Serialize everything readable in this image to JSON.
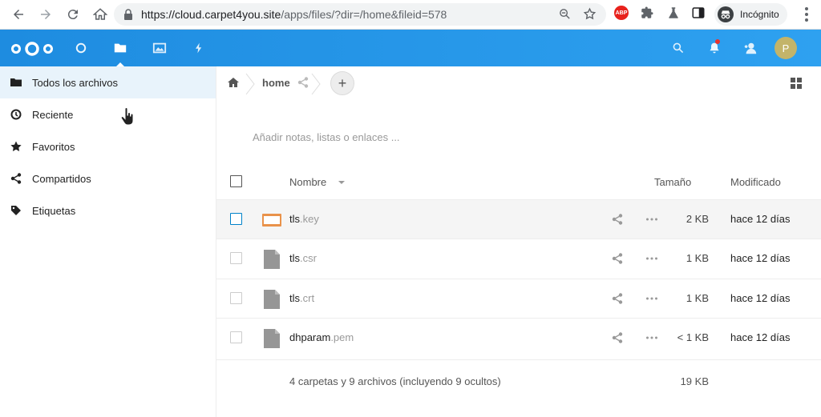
{
  "browser": {
    "url_host": "https://cloud.carpet4you.site",
    "url_path": "/apps/files/?dir=/home&fileid=578",
    "abp_label": "ABP",
    "incognito_label": "Incógnito"
  },
  "header": {
    "avatar_letter": "P"
  },
  "sidebar": {
    "items": [
      {
        "label": "Todos los archivos"
      },
      {
        "label": "Reciente"
      },
      {
        "label": "Favoritos"
      },
      {
        "label": "Compartidos"
      },
      {
        "label": "Etiquetas"
      }
    ]
  },
  "breadcrumb": {
    "current": "home"
  },
  "notes_placeholder": "Añadir notas, listas o enlaces ...",
  "table": {
    "columns": {
      "name": "Nombre",
      "size": "Tamaño",
      "modified": "Modificado"
    },
    "rows": [
      {
        "base": "tls",
        "ext": ".key",
        "size": "2 KB",
        "modified": "hace 12 días"
      },
      {
        "base": "tls",
        "ext": ".csr",
        "size": "1 KB",
        "modified": "hace 12 días"
      },
      {
        "base": "tls",
        "ext": ".crt",
        "size": "1 KB",
        "modified": "hace 12 días"
      },
      {
        "base": "dhparam",
        "ext": ".pem",
        "size": "< 1 KB",
        "modified": "hace 12 días"
      }
    ],
    "summary": {
      "text": "4 carpetas y 9 archivos (incluyendo 9 ocultos)",
      "size": "19 KB"
    }
  },
  "colors": {
    "header_gradient_start": "#1e8ce0",
    "header_gradient_end": "#2ea1f0",
    "active_sidebar": "#e8f3fb",
    "avatar": "#c3b46a",
    "key_icon": "#e9924a",
    "file_icon": "#969696"
  }
}
